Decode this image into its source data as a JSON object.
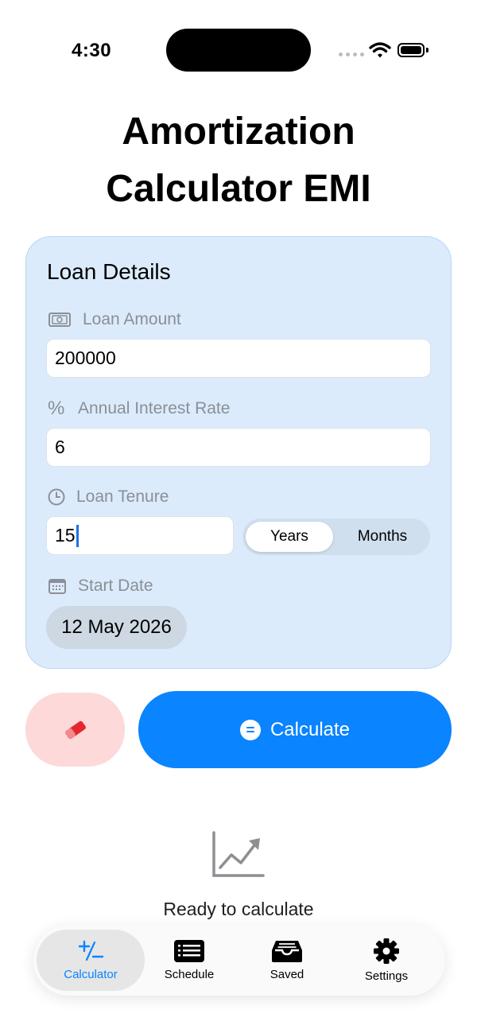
{
  "status_bar": {
    "time": "4:30"
  },
  "page": {
    "title_line1": "Amortization",
    "title_line2": "Calculator EMI"
  },
  "loan_details": {
    "heading": "Loan Details",
    "loan_amount_label": "Loan Amount",
    "loan_amount_value": "200000",
    "interest_rate_label": "Annual Interest Rate",
    "interest_rate_value": "6",
    "tenure_label": "Loan Tenure",
    "tenure_value": "15",
    "tenure_units": {
      "selected": "Years",
      "options": [
        "Years",
        "Months"
      ]
    },
    "start_date_label": "Start Date",
    "start_date_value": "12 May 2026"
  },
  "actions": {
    "calculate_label": "Calculate"
  },
  "empty_state": {
    "message": "Ready to calculate"
  },
  "tab_bar": {
    "items": [
      {
        "label": "Calculator",
        "icon": "plus-minus-icon",
        "active": true
      },
      {
        "label": "Schedule",
        "icon": "list-icon",
        "active": false
      },
      {
        "label": "Saved",
        "icon": "tray-icon",
        "active": false
      },
      {
        "label": "Settings",
        "icon": "gear-icon",
        "active": false
      }
    ]
  },
  "colors": {
    "accent": "#0a84ff",
    "card_bg": "#dcebfb",
    "clear_bg": "#fdd9d9",
    "eraser": "#e5262f"
  }
}
